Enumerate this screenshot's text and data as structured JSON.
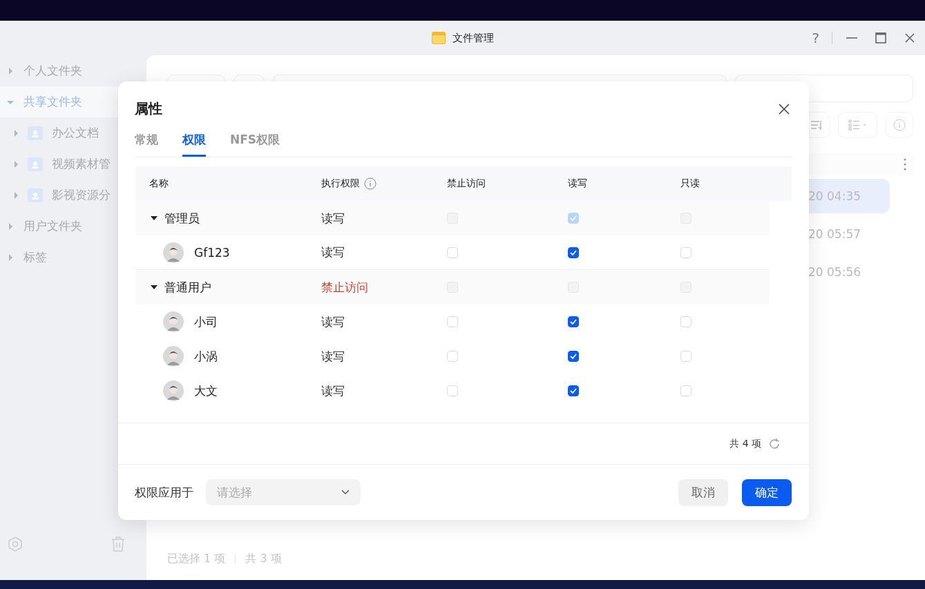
{
  "window": {
    "title": "文件管理",
    "help_label": "?"
  },
  "sidebar": {
    "items": [
      {
        "label": "个人文件夹",
        "expanded": false,
        "selected": false
      },
      {
        "label": "共享文件夹",
        "expanded": true,
        "selected": true,
        "children": [
          {
            "label": "办公文档",
            "expanded": false,
            "selected": false
          },
          {
            "label": "视频素材管",
            "expanded": false,
            "selected": false
          },
          {
            "label": "影视资源分",
            "expanded": false,
            "selected": false
          }
        ]
      },
      {
        "label": "用户文件夹",
        "expanded": false,
        "selected": false
      },
      {
        "label": "标签",
        "expanded": false,
        "selected": false
      }
    ]
  },
  "file_list": {
    "rows": [
      {
        "time": "20 04:35",
        "selected": true
      },
      {
        "time": "20 05:57",
        "selected": false
      },
      {
        "time": "20 05:56",
        "selected": false
      }
    ]
  },
  "status_bar": {
    "selected": "已选择 1 项",
    "total": "共 3 项"
  },
  "dialog": {
    "title": "属性",
    "tabs": [
      {
        "label": "常规",
        "selected": false
      },
      {
        "label": "权限",
        "selected": true
      },
      {
        "label": "NFS权限",
        "selected": false
      }
    ],
    "columns": [
      {
        "label": "名称",
        "has_info": false
      },
      {
        "label": "执行权限",
        "has_info": true
      },
      {
        "label": "禁止访问",
        "has_info": false
      },
      {
        "label": "读写",
        "has_info": false
      },
      {
        "label": "只读",
        "has_info": false
      }
    ],
    "groups": [
      {
        "name": "管理员",
        "expanded": true,
        "exec": "读写",
        "denied": false,
        "checks": [
          {
            "checked": false,
            "disabled": true
          },
          {
            "checked": true,
            "disabled": true
          },
          {
            "checked": false,
            "disabled": true
          }
        ],
        "children": [
          {
            "name": "Gf123",
            "exec": "读写",
            "denied": false,
            "checks": [
              {
                "checked": false,
                "disabled": false
              },
              {
                "checked": true,
                "disabled": false
              },
              {
                "checked": false,
                "disabled": false
              }
            ]
          }
        ]
      },
      {
        "name": "普通用户",
        "expanded": true,
        "exec": "禁止访问",
        "denied": true,
        "checks": [
          {
            "checked": false,
            "disabled": true
          },
          {
            "checked": false,
            "disabled": true
          },
          {
            "checked": false,
            "disabled": true
          }
        ],
        "children": [
          {
            "name": "小司",
            "exec": "读写",
            "denied": false,
            "checks": [
              {
                "checked": false,
                "disabled": false
              },
              {
                "checked": true,
                "disabled": false
              },
              {
                "checked": false,
                "disabled": false
              }
            ]
          },
          {
            "name": "小涡",
            "exec": "读写",
            "denied": false,
            "checks": [
              {
                "checked": false,
                "disabled": false
              },
              {
                "checked": true,
                "disabled": false
              },
              {
                "checked": false,
                "disabled": false
              }
            ]
          },
          {
            "name": "大文",
            "exec": "读写",
            "denied": false,
            "checks": [
              {
                "checked": false,
                "disabled": false
              },
              {
                "checked": true,
                "disabled": false
              },
              {
                "checked": false,
                "disabled": false
              }
            ]
          }
        ]
      }
    ],
    "count": "共 4 项",
    "apply_label": "权限应用于",
    "apply_select": {
      "placeholder": "请选择"
    },
    "buttons": [
      {
        "label": "取消",
        "kind": "secondary"
      },
      {
        "label": "确定",
        "kind": "primary"
      }
    ]
  }
}
